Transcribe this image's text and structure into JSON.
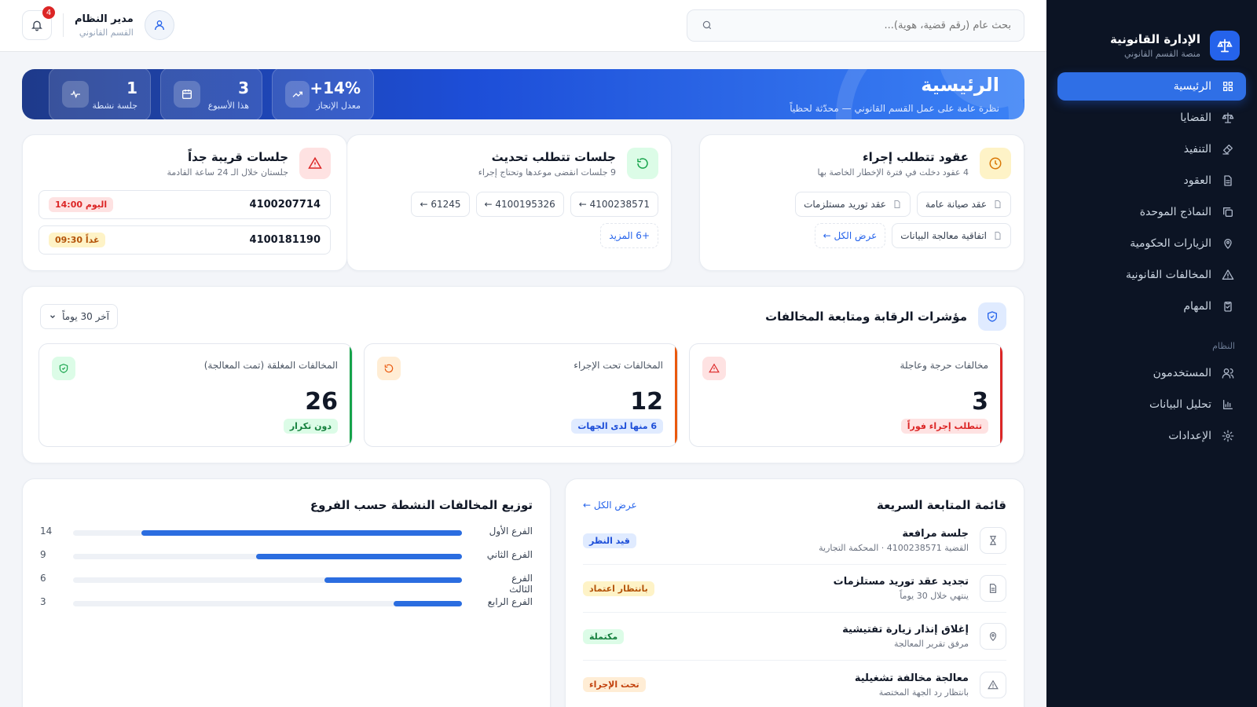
{
  "sidebar": {
    "brand_title": "الإدارة القانونية",
    "brand_sub": "منصة القسم القانوني",
    "items": [
      {
        "label": "الرئيسية",
        "icon": "grid-icon",
        "active": true
      },
      {
        "label": "القضايا",
        "icon": "scale-icon"
      },
      {
        "label": "التنفيذ",
        "icon": "gavel-icon"
      },
      {
        "label": "العقود",
        "icon": "document-icon"
      },
      {
        "label": "النماذج الموحدة",
        "icon": "copy-icon"
      },
      {
        "label": "الزيارات الحكومية",
        "icon": "map-pin-icon"
      },
      {
        "label": "المخالفات القانونية",
        "icon": "warning-icon"
      },
      {
        "label": "المهام",
        "icon": "clipboard-icon"
      }
    ],
    "section_label": "النظام",
    "system_items": [
      {
        "label": "المستخدمون",
        "icon": "users-icon"
      },
      {
        "label": "تحليل البيانات",
        "icon": "bar-chart-icon"
      },
      {
        "label": "الإعدادات",
        "icon": "gear-icon"
      }
    ]
  },
  "topbar": {
    "search_placeholder": "بحث عام (رقم قضية، هوية)...",
    "user_name": "مدير النظام",
    "user_role": "القسم القانوني",
    "notifications": "4"
  },
  "hero": {
    "title": "الرئيسية",
    "subtitle": "نظرة عامة على عمل القسم القانوني — محدّثة لحظياً",
    "stats": [
      {
        "value": "1",
        "label": "جلسة نشطة",
        "icon": "activity-icon"
      },
      {
        "value": "3",
        "label": "هذا الأسبوع",
        "icon": "calendar-icon"
      },
      {
        "value": "14%+",
        "label": "معدل الإنجاز",
        "icon": "trend-up-icon"
      }
    ]
  },
  "contracts_card": {
    "title": "عقود تتطلب إجراء",
    "subtitle": "4 عقود دخلت في فترة الإخطار الخاصة بها",
    "chips": [
      "عقد صيانة عامة",
      "عقد توريد مستلزمات",
      "اتفاقية معالجة البيانات"
    ],
    "view_all": "عرض الكل ←"
  },
  "update_card": {
    "title": "جلسات تتطلب تحديث",
    "subtitle": "9 جلسات انقضى موعدها وتحتاج إجراء",
    "chips": [
      "4100238571 ←",
      "4100195326 ←",
      "61245 ←"
    ],
    "more": "+6 المزيد"
  },
  "soon_card": {
    "title": "جلسات قريبة جداً",
    "subtitle": "جلستان خلال الـ 24 ساعة القادمة",
    "rows": [
      {
        "number": "4100207714",
        "time": "اليوم 14:00"
      },
      {
        "number": "4100181190",
        "time": "غداً 09:30"
      }
    ]
  },
  "monitoring": {
    "title": "مؤشرات الرقابة ومتابعة المخالفات",
    "period": "آخر 30 يوماً",
    "kpis": [
      {
        "title": "مخالفات حرجة وعاجلة",
        "value": "3",
        "badge": "تتطلب إجراء فوراً",
        "color": "#dc2626"
      },
      {
        "title": "المخالفات تحت الإجراء",
        "value": "12",
        "badge": "6 منها لدى الجهات",
        "color": "#ea580c"
      },
      {
        "title": "المخالفات المغلقة (تمت المعالجة)",
        "value": "26",
        "badge": "دون تكرار",
        "color": "#16a34a"
      }
    ]
  },
  "followup": {
    "title": "قائمة المتابعة السريعة",
    "view_all": "عرض الكل ←",
    "items": [
      {
        "title": "جلسة مرافعة",
        "sub": "القضية 4100238571 · المحكمة التجارية",
        "status": "قيد النظر",
        "icon": "hourglass-icon"
      },
      {
        "title": "تجديد عقد توريد مستلزمات",
        "sub": "ينتهي خلال 30 يوماً",
        "status": "بانتظار اعتماد",
        "icon": "document-icon"
      },
      {
        "title": "إغلاق إنذار زيارة تفتيشية",
        "sub": "مرفق تقرير المعالجة",
        "status": "مكتملة",
        "icon": "map-pin-icon"
      },
      {
        "title": "معالجة مخالفة تشغيلية",
        "sub": "بانتظار رد الجهة المختصة",
        "status": "تحت الإجراء",
        "icon": "warning-icon"
      }
    ]
  },
  "distribution": {
    "title": "توزيع المخالفات النشطة حسب الفروع"
  },
  "chart_data": {
    "type": "bar",
    "title": "توزيع المخالفات النشطة حسب الفروع",
    "categories": [
      "الفرع الأول",
      "الفرع الثاني",
      "الفرع الثالث",
      "الفرع الرابع"
    ],
    "values": [
      14,
      9,
      6,
      3
    ],
    "ylim": [
      0,
      17
    ]
  },
  "colors": {
    "accent": "#2563eb",
    "sidebar_bg": "#0c1424",
    "danger": "#dc2626",
    "warning": "#ea580c",
    "success": "#16a34a"
  }
}
